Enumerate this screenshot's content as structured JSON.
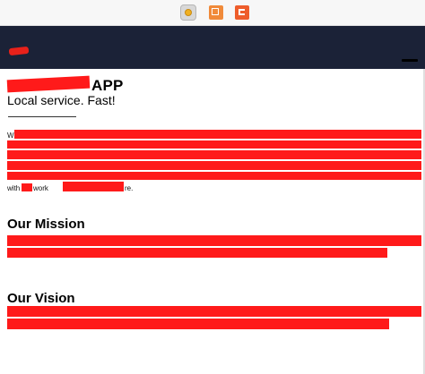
{
  "toolbar": {
    "icons": [
      "plugin-icon",
      "cube-icon",
      "exit-icon"
    ]
  },
  "header": {
    "title": "APP",
    "tagline": "Local service. Fast!"
  },
  "about": {
    "line_start": "W",
    "last_line_prefix": "with",
    "last_line_fragment": "work",
    "last_line_suffix": "re."
  },
  "mission": {
    "heading": "Our Mission"
  },
  "vision": {
    "heading": "Our Vision"
  },
  "colors": {
    "navbar": "#1b2237",
    "redaction": "#ff1a1a"
  }
}
